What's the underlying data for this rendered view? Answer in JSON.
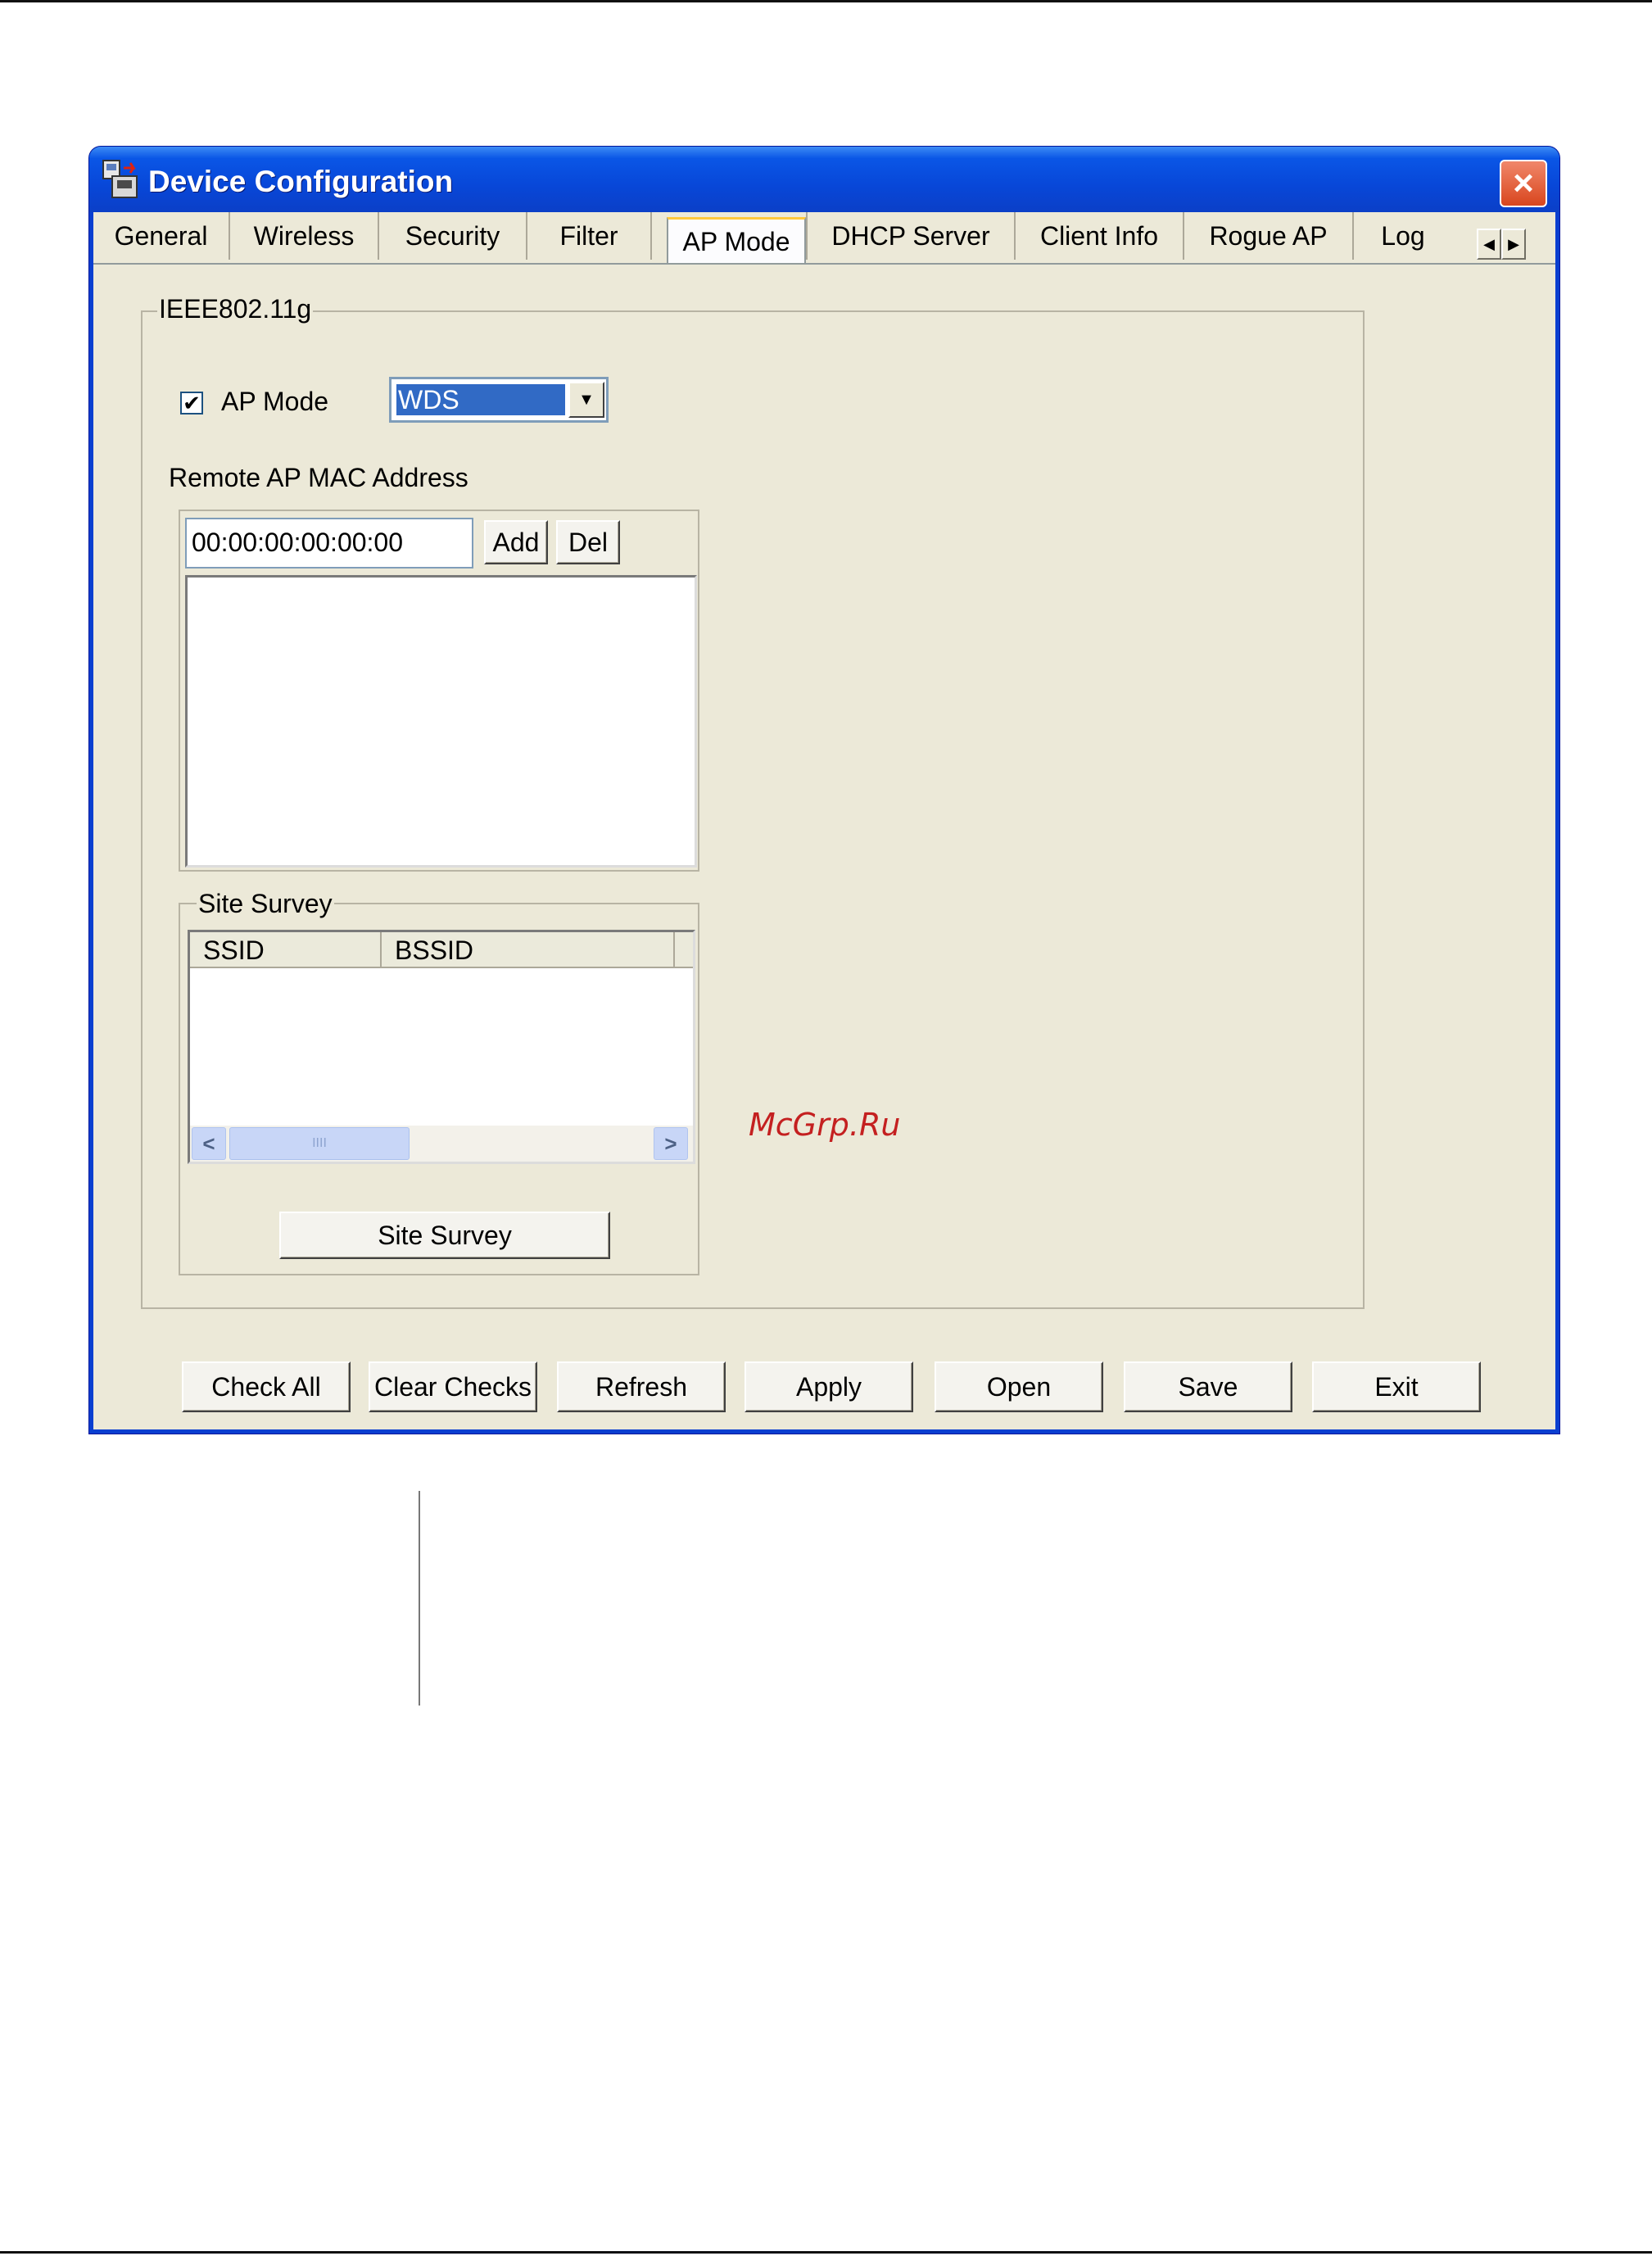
{
  "window": {
    "title": "Device Configuration",
    "close_label": "×"
  },
  "tabs": [
    {
      "label": "General"
    },
    {
      "label": "Wireless"
    },
    {
      "label": "Security"
    },
    {
      "label": "Filter"
    },
    {
      "label": "AP Mode",
      "active": true
    },
    {
      "label": "DHCP Server"
    },
    {
      "label": "Client Info"
    },
    {
      "label": "Rogue AP"
    },
    {
      "label": "Log"
    }
  ],
  "tab_scroll": {
    "left": "◀",
    "right": "▶"
  },
  "group": {
    "legend": "IEEE802.11g",
    "ap_mode": {
      "label": "AP Mode",
      "checked": true,
      "check_glyph": "✔",
      "selected": "WDS",
      "dropdown_glyph": "▼"
    },
    "remote_mac": {
      "label": "Remote AP MAC Address",
      "value": "00:00:00:00:00:00",
      "add_label": "Add",
      "del_label": "Del"
    },
    "site_survey": {
      "legend": "Site Survey",
      "columns": [
        "SSID",
        "BSSID"
      ],
      "scroll_left": "<",
      "scroll_right": ">",
      "thumb_grip": "IIII",
      "button_label": "Site  Survey"
    }
  },
  "footer_buttons": [
    "Check All",
    "Clear Checks",
    "Refresh",
    "Apply",
    "Open",
    "Save",
    "Exit"
  ],
  "watermark": "McGrp.Ru"
}
